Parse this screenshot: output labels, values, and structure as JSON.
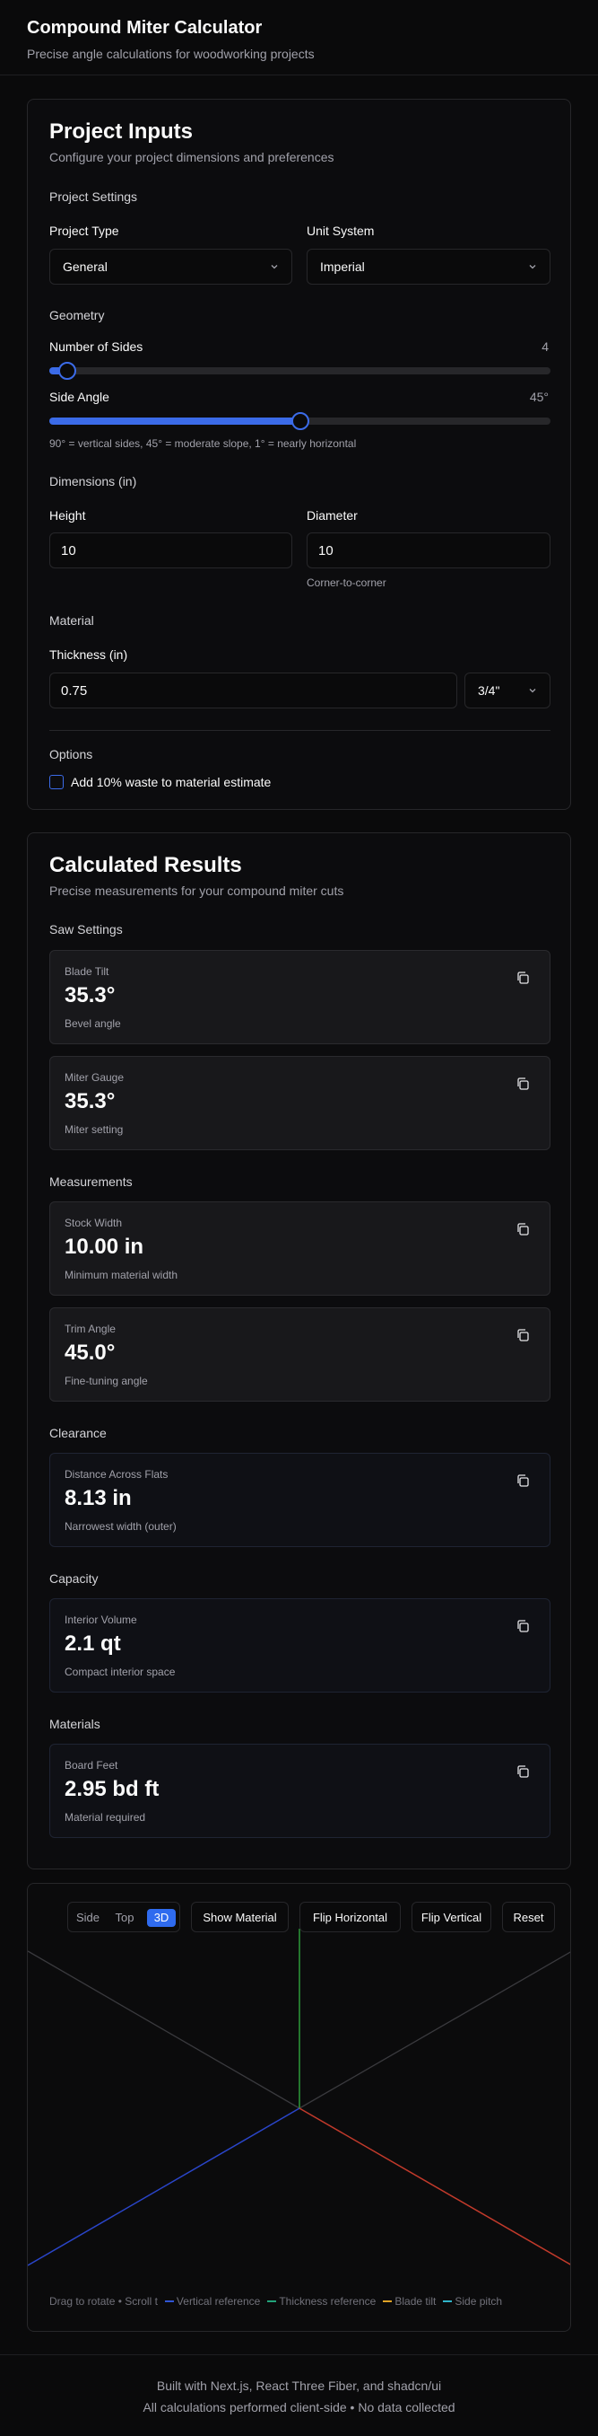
{
  "header": {
    "title": "Compound Miter Calculator",
    "subtitle": "Precise angle calculations for woodworking projects"
  },
  "inputs": {
    "title": "Project Inputs",
    "subtitle": "Configure your project dimensions and preferences",
    "project_settings_label": "Project Settings",
    "project_type_label": "Project Type",
    "project_type_value": "General",
    "unit_system_label": "Unit System",
    "unit_system_value": "Imperial",
    "geometry_label": "Geometry",
    "sides_label": "Number of Sides",
    "sides_value": "4",
    "sides_fraction": 0.0,
    "side_angle_label": "Side Angle",
    "side_angle_value": "45°",
    "side_angle_fraction": 0.5,
    "side_angle_hint": "90° = vertical sides, 45° = moderate slope, 1° = nearly horizontal",
    "dimensions_label": "Dimensions (in)",
    "height_label": "Height",
    "height_value": "10",
    "diameter_label": "Diameter",
    "diameter_value": "10",
    "diameter_hint": "Corner-to-corner",
    "material_label": "Material",
    "thickness_label": "Thickness (in)",
    "thickness_value": "0.75",
    "thickness_preset": "3/4\"",
    "options_label": "Options",
    "waste_label": "Add 10% waste to material estimate",
    "waste_checked": false
  },
  "results": {
    "title": "Calculated Results",
    "subtitle": "Precise measurements for your compound miter cuts",
    "saw_settings_label": "Saw Settings",
    "blade_tilt": {
      "label": "Blade Tilt",
      "value": "35.3°",
      "desc": "Bevel angle"
    },
    "miter_gauge": {
      "label": "Miter Gauge",
      "value": "35.3°",
      "desc": "Miter setting"
    },
    "measurements_label": "Measurements",
    "stock_width": {
      "label": "Stock Width",
      "value": "10.00 in",
      "desc": "Minimum material width"
    },
    "trim_angle": {
      "label": "Trim Angle",
      "value": "45.0°",
      "desc": "Fine-tuning angle"
    },
    "clearance_label": "Clearance",
    "distance_flats": {
      "label": "Distance Across Flats",
      "value": "8.13 in",
      "desc": "Narrowest width (outer)"
    },
    "capacity_label": "Capacity",
    "interior_volume": {
      "label": "Interior Volume",
      "value": "2.1 qt",
      "desc": "Compact interior space"
    },
    "materials_label": "Materials",
    "board_feet": {
      "label": "Board Feet",
      "value": "2.95 bd ft",
      "desc": "Material required"
    }
  },
  "viewer": {
    "view_side": "Side",
    "view_top": "Top",
    "view_3d": "3D",
    "active_view": "3D",
    "show_material": "Show Material",
    "flip_horizontal": "Flip Horizontal",
    "flip_vertical": "Flip Vertical",
    "reset": "Reset",
    "instructions": "Drag to rotate • Scroll t",
    "legend": {
      "vertical": "Vertical reference",
      "thickness": "Thickness reference",
      "blade_tilt": "Blade tilt",
      "side_pitch": "Side pitch"
    },
    "colors": {
      "vertical": "#2f55d4",
      "thickness": "#22a37a",
      "blade_tilt": "#e0a326",
      "side_pitch": "#2fb4c9",
      "axis_x": "#c23a2b",
      "axis_y": "#2c9a3a",
      "axis_z": "#2a45c9"
    }
  },
  "footer": {
    "line1": "Built with Next.js, React Three Fiber, and shadcn/ui",
    "line2": "All calculations performed client-side • No data collected"
  }
}
